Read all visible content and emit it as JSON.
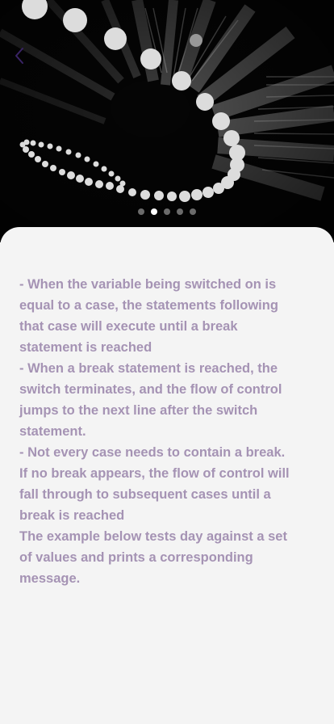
{
  "hero": {
    "image_name": "spiral-building-bokeh-photo",
    "back_icon": "chevron-left-icon",
    "carousel": {
      "count": 5,
      "active_index": 1
    }
  },
  "content": {
    "paragraphs": [
      "- When the variable being switched on is equal to a case, the statements following that case will execute until a break statement is reached",
      "- When a break statement is reached, the switch terminates, and the flow of control jumps to the next line after the switch statement.",
      "- Not every case needs to contain a break. If no break appears, the flow of control will fall through to subsequent cases until a break is reached",
      "The example below tests day against a set of values and prints a corresponding message."
    ]
  },
  "colors": {
    "text": "#a593b4",
    "background": "#f4f4f4",
    "hero_background": "#000000",
    "dot_active": "#ffffff",
    "dot_inactive": "#6b6b6b"
  }
}
